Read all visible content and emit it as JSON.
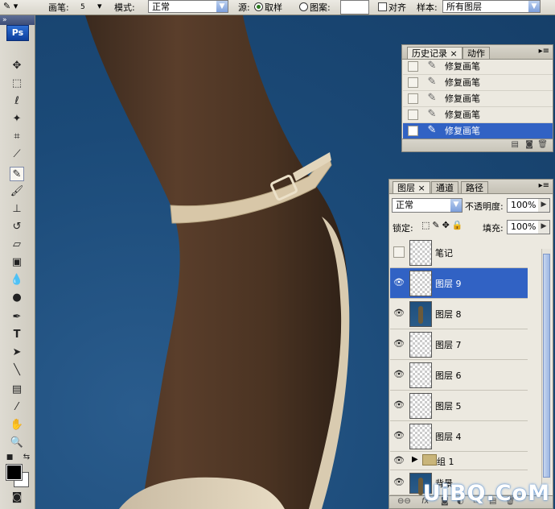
{
  "options_bar": {
    "brush_label": "画笔:",
    "brush_size": "5",
    "mode_label": "模式:",
    "mode_value": "正常",
    "source_label": "源:",
    "sampled_label": "取样",
    "pattern_label": "图案:",
    "aligned_label": "对齐",
    "sample_label": "样本:",
    "sample_value": "所有图层"
  },
  "toolbox": {
    "logo": "Ps"
  },
  "history_panel": {
    "tabs": [
      "历史记录",
      "动作"
    ],
    "items": [
      {
        "label": "修复画笔",
        "selected": false
      },
      {
        "label": "修复画笔",
        "selected": false
      },
      {
        "label": "修复画笔",
        "selected": false
      },
      {
        "label": "修复画笔",
        "selected": false
      },
      {
        "label": "修复画笔",
        "selected": true
      }
    ]
  },
  "layers_panel": {
    "tabs": [
      "图层",
      "通道",
      "路径"
    ],
    "blend_mode": "正常",
    "opacity_label": "不透明度:",
    "opacity_value": "100%",
    "lock_label": "锁定:",
    "fill_label": "填充:",
    "fill_value": "100%",
    "layers": [
      {
        "name": "笔记",
        "visible": false,
        "selected": false,
        "thumb": "transparent"
      },
      {
        "name": "图层 9",
        "visible": true,
        "selected": true,
        "thumb": "transparent"
      },
      {
        "name": "图层 8",
        "visible": true,
        "selected": false,
        "thumb": "photo"
      },
      {
        "name": "图层 7",
        "visible": true,
        "selected": false,
        "thumb": "transparent"
      },
      {
        "name": "图层 6",
        "visible": true,
        "selected": false,
        "thumb": "transparent"
      },
      {
        "name": "图层 5",
        "visible": true,
        "selected": false,
        "thumb": "transparent"
      },
      {
        "name": "图层 4",
        "visible": true,
        "selected": false,
        "thumb": "transparent"
      }
    ],
    "group_name": "组 1",
    "bottom_layer_name": "背景"
  },
  "watermark": "UiBQ.CoM"
}
